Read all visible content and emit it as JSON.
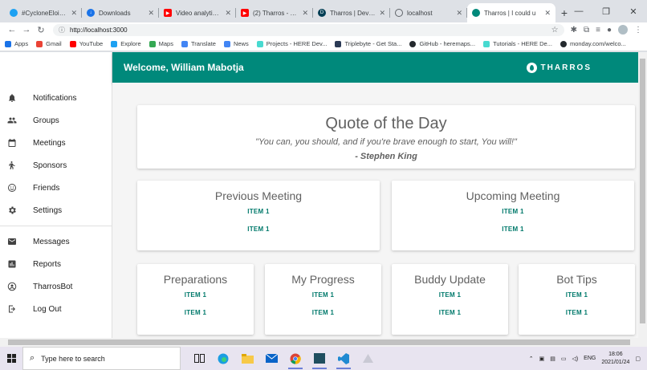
{
  "browser": {
    "tabs": [
      {
        "title": "#CycloneEloise - T",
        "icon": "twitter-icon",
        "color": "#1da1f2",
        "active": false
      },
      {
        "title": "Downloads",
        "icon": "download-icon",
        "color": "#1a73e8",
        "active": false
      },
      {
        "title": "Video analytics - Y",
        "icon": "youtube-icon",
        "color": "#ff0000",
        "active": false
      },
      {
        "title": "(2) Tharros - YaleC",
        "icon": "youtube-icon",
        "color": "#ff0000",
        "active": false
      },
      {
        "title": "Tharros | Devpost",
        "icon": "devpost-icon",
        "color": "#003e54",
        "active": false
      },
      {
        "title": "localhost",
        "icon": "globe-icon",
        "color": "#5f6368",
        "active": false
      },
      {
        "title": "Tharros | I could u",
        "icon": "tharros-icon",
        "color": "#00897b",
        "active": true
      }
    ],
    "url": "http://localhost:3000",
    "bookmarks": [
      {
        "label": "Apps",
        "color": "#1a73e8"
      },
      {
        "label": "Gmail",
        "color": "#ea4335"
      },
      {
        "label": "YouTube",
        "color": "#ff0000"
      },
      {
        "label": "Explore",
        "color": "#1da1f2"
      },
      {
        "label": "Maps",
        "color": "#34a853"
      },
      {
        "label": "Translate",
        "color": "#4285f4"
      },
      {
        "label": "News",
        "color": "#4285f4"
      },
      {
        "label": "Projects - HERE Dev...",
        "color": "#48dad0"
      },
      {
        "label": "Triplebyte - Get Sta...",
        "color": "#2b3a55"
      },
      {
        "label": "GitHub - heremaps...",
        "color": "#24292e"
      },
      {
        "label": "Tutorials - HERE De...",
        "color": "#48dad0"
      },
      {
        "label": "monday.com/welco...",
        "color": "#24292e"
      }
    ]
  },
  "app": {
    "welcome": "Welcome, William Mabotja",
    "brand": "THARROS",
    "accent": "#00897b",
    "sidebar_top": [
      {
        "label": "Notifications",
        "icon": "bell-icon"
      },
      {
        "label": "Groups",
        "icon": "groups-icon"
      },
      {
        "label": "Meetings",
        "icon": "calendar-icon"
      },
      {
        "label": "Sponsors",
        "icon": "sponsor-icon"
      },
      {
        "label": "Friends",
        "icon": "smiley-icon"
      },
      {
        "label": "Settings",
        "icon": "gear-icon"
      }
    ],
    "sidebar_bottom": [
      {
        "label": "Messages",
        "icon": "mail-icon"
      },
      {
        "label": "Reports",
        "icon": "chart-icon"
      },
      {
        "label": "TharrosBot",
        "icon": "account-icon"
      },
      {
        "label": "Log Out",
        "icon": "logout-icon"
      }
    ],
    "quote": {
      "title": "Quote of the Day",
      "text": "\"You can, you should, and if you're brave enough to start, You will!\"",
      "author": "- Stephen King"
    },
    "mid_cards": [
      {
        "title": "Previous Meeting",
        "items": [
          "ITEM 1",
          "ITEM 1"
        ]
      },
      {
        "title": "Upcoming Meeting",
        "items": [
          "ITEM 1",
          "ITEM 1"
        ]
      }
    ],
    "small_cards": [
      {
        "title": "Preparations",
        "items": [
          "ITEM 1",
          "ITEM 1"
        ]
      },
      {
        "title": "My Progress",
        "items": [
          "ITEM 1",
          "ITEM 1"
        ]
      },
      {
        "title": "Buddy Update",
        "items": [
          "ITEM 1",
          "ITEM 1"
        ]
      },
      {
        "title": "Bot Tips",
        "items": [
          "ITEM 1",
          "ITEM 1"
        ]
      }
    ]
  },
  "taskbar": {
    "search_placeholder": "Type here to search",
    "language": "ENG",
    "time": "18:06",
    "date": "2021/01/24"
  }
}
